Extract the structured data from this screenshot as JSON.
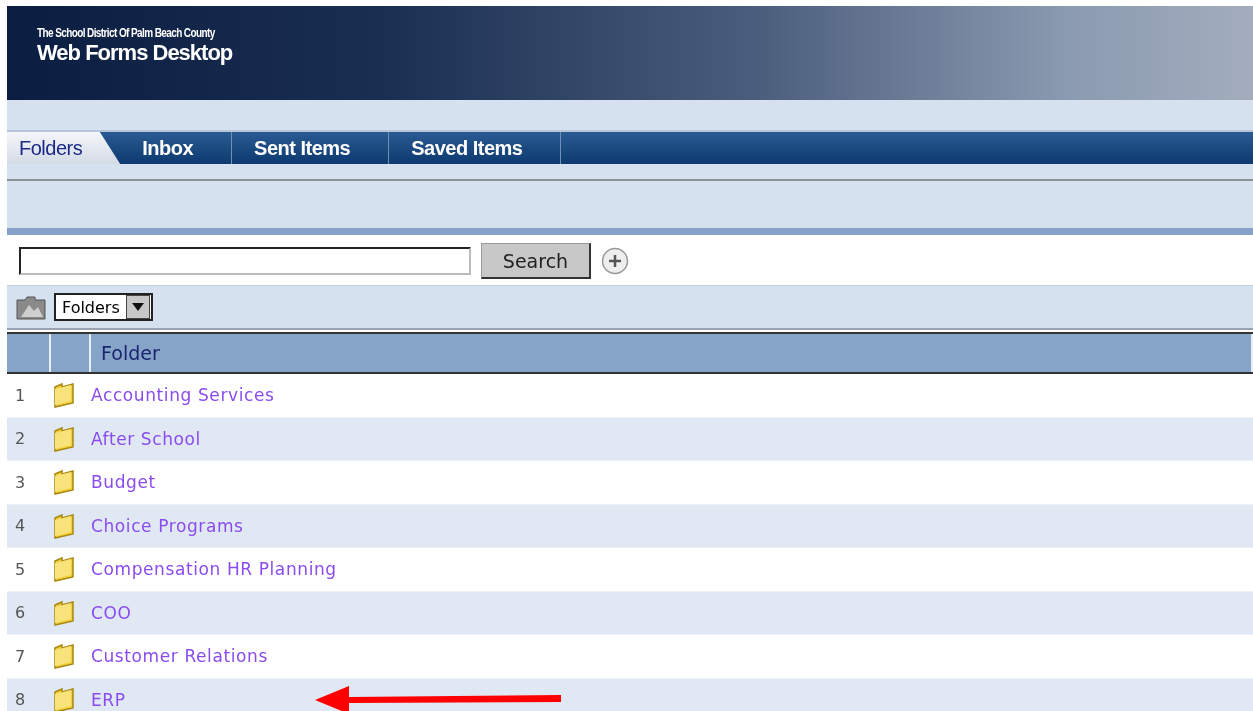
{
  "header": {
    "subtitle": "The School District Of Palm Beach County",
    "title": "Web Forms Desktop"
  },
  "tabs": [
    {
      "label": "Folders",
      "selected": true
    },
    {
      "label": "Inbox",
      "selected": false
    },
    {
      "label": "Sent Items",
      "selected": false
    },
    {
      "label": "Saved Items",
      "selected": false
    }
  ],
  "search": {
    "button": "Search"
  },
  "view_select": {
    "value": "Folders"
  },
  "table": {
    "columns": [
      "Folder"
    ],
    "rows": [
      {
        "number": "1",
        "name": "Accounting Services"
      },
      {
        "number": "2",
        "name": "After School"
      },
      {
        "number": "3",
        "name": "Budget"
      },
      {
        "number": "4",
        "name": "Choice Programs"
      },
      {
        "number": "5",
        "name": "Compensation HR Planning"
      },
      {
        "number": "6",
        "name": "COO"
      },
      {
        "number": "7",
        "name": "Customer Relations"
      },
      {
        "number": "8",
        "name": "ERP",
        "arrow": true
      }
    ]
  }
}
